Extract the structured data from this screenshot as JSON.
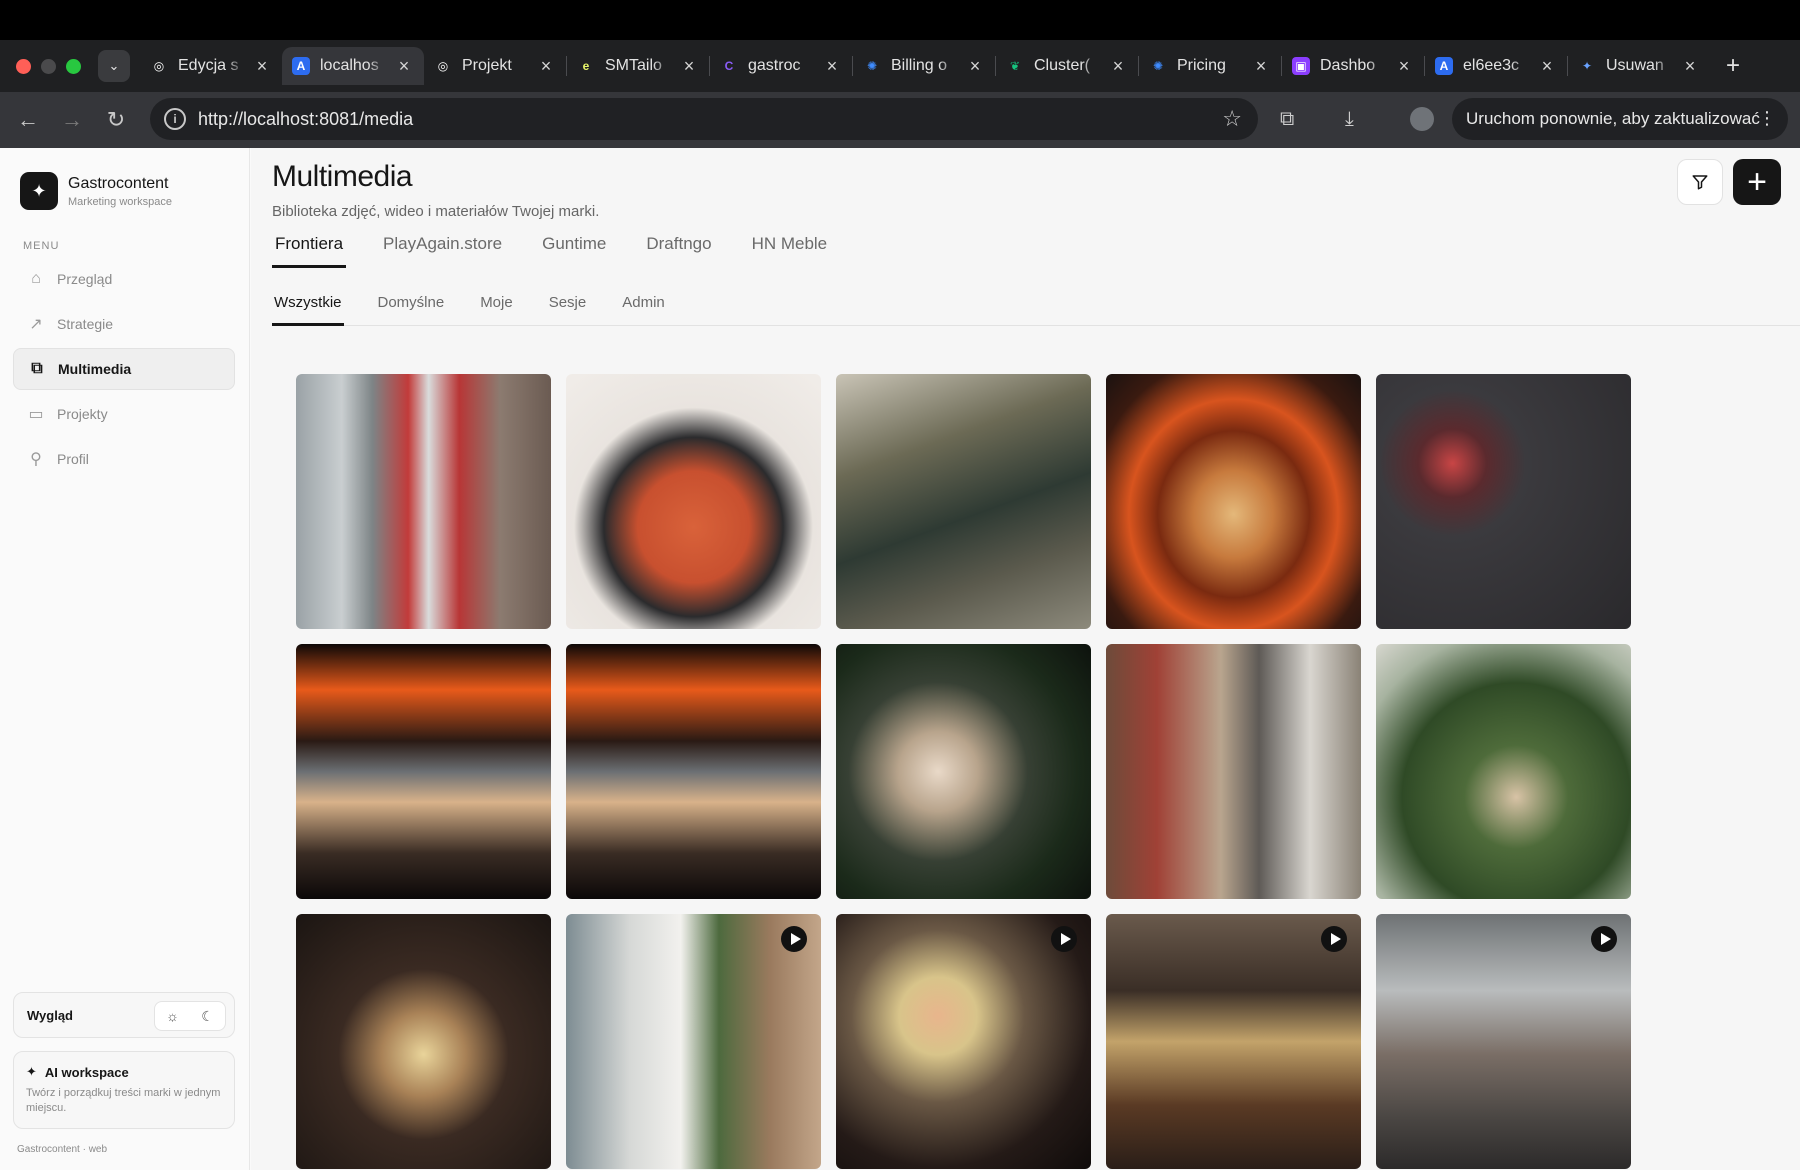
{
  "browser": {
    "tabs": [
      {
        "title": "Edycja s",
        "icon": "openai-icon",
        "color": "#ffffff"
      },
      {
        "title": "localhos",
        "icon": "a-logo-icon",
        "color": "#4d8bf5",
        "active": true
      },
      {
        "title": "Projekt",
        "icon": "openai-icon",
        "color": "#ffffff"
      },
      {
        "title": "SMTailo",
        "icon": "e-logo-icon",
        "color": "#e6f46a"
      },
      {
        "title": "gastroc",
        "icon": "c-logo-icon",
        "color": "#8a5cf6"
      },
      {
        "title": "Billing o",
        "icon": "gear-logo-icon",
        "color": "#3f8cff"
      },
      {
        "title": "Cluster(",
        "icon": "leaf-icon",
        "color": "#16c47f"
      },
      {
        "title": "Pricing",
        "icon": "gear-logo-icon",
        "color": "#3f8cff"
      },
      {
        "title": "Dashbo",
        "icon": "chat-logo-icon",
        "color": "#8b3dff"
      },
      {
        "title": "el6ee3c",
        "icon": "a-logo-icon",
        "color": "#4d8bf5"
      },
      {
        "title": "Usuwan",
        "icon": "gemini-icon",
        "color": "#6aa3ff"
      }
    ],
    "url": "http://localhost:8081/media",
    "update_label": "Uruchom ponownie, aby zaktualizować"
  },
  "sidebar": {
    "brand_name": "Gastrocontent",
    "brand_sub": "Marketing workspace",
    "menu_label": "MENU",
    "items": [
      {
        "label": "Przegląd",
        "icon": "home-icon"
      },
      {
        "label": "Strategie",
        "icon": "trend-icon"
      },
      {
        "label": "Multimedia",
        "icon": "media-icon",
        "active": true
      },
      {
        "label": "Projekty",
        "icon": "folder-icon"
      },
      {
        "label": "Profil",
        "icon": "user-icon"
      }
    ],
    "appearance_label": "Wygląd",
    "ai_title": "AI workspace",
    "ai_desc": "Twórz i porządkuj treści marki w jednym miejscu.",
    "footer": "Gastrocontent · web"
  },
  "main": {
    "title": "Multimedia",
    "subtitle": "Biblioteka zdjęć, wideo i materiałów Twojej marki.",
    "brand_tabs": [
      "Frontiera",
      "PlayAgain.store",
      "Guntime",
      "Draftngo",
      "HN Meble"
    ],
    "filter_tabs": [
      "Wszystkie",
      "Domyślne",
      "Moje",
      "Sesje",
      "Admin"
    ]
  },
  "media": [
    {
      "type": "image",
      "bg": "linear-gradient(90deg,#9aa2a6 0%,#c9ced0 18%,#7d8486 30%,#c23b3a 44%,#d9dcdc 52%,#b83636 64%,#8c7b70 80%,#6b5b52 100%)"
    },
    {
      "type": "image",
      "bg": "radial-gradient(circle at 50% 60%,#d9623a 0%,#c8502f 28%,#2b2b2d 45%,#e9e4df 60%,#f1ede9 100%)"
    },
    {
      "type": "image",
      "bg": "linear-gradient(160deg,#c9c4b6 0%,#6c6a55 30%,#2e3a33 55%,#5b5a4d 75%,#8d8a7c 100%)"
    },
    {
      "type": "image",
      "bg": "radial-gradient(ellipse at 50% 55%,#e4b87a 0%,#c77a3d 22%,#7a2a10 42%,#d8541e 58%,#3a1a10 80%,#1b1210 100%)"
    },
    {
      "type": "image",
      "bg": "radial-gradient(circle at 30% 35%,#c84545 0%,#5b2a2e 14%,#3b3a3e 30%,#2a292c 100%)"
    },
    {
      "type": "image",
      "bg": "linear-gradient(180deg,#0d0807 0%,#e85a1a 18%,#2a1a14 38%,#6b6f73 50%,#d8b28a 62%,#3a2c24 82%,#0b0808 100%)"
    },
    {
      "type": "image",
      "bg": "linear-gradient(180deg,#0d0807 0%,#e85a1a 18%,#2a1a14 38%,#6b6f73 50%,#d8b28a 62%,#3a2c24 82%,#0b0808 100%)"
    },
    {
      "type": "image",
      "bg": "radial-gradient(circle at 40% 50%,#e9d9c8 0%,#b8a48c 20%,#374034 45%,#1b2a1a 70%,#0d120d 100%)"
    },
    {
      "type": "image",
      "bg": "linear-gradient(90deg,#6d4b3a 0%,#a04136 20%,#b9a58e 45%,#5e5a56 60%,#d9d6d0 80%,#8a8276 100%)"
    },
    {
      "type": "image",
      "bg": "radial-gradient(circle at 55% 60%,#d8c3a6 0%,#4e6b3a 25%,#2f4a26 55%,#a7b3a0 80%,#d7d7cf 100%)"
    },
    {
      "type": "image",
      "bg": "radial-gradient(circle at 50% 55%,#e9d49a 0%,#a98257 22%,#3a2a22 45%,#1b1512 100%)"
    },
    {
      "type": "video",
      "bg": "linear-gradient(90deg,#7d8c92 0%,#d6d8d6 25%,#f2f1ee 45%,#4d6a3e 60%,#9a7a5e 80%,#c3a68a 100%)"
    },
    {
      "type": "video",
      "bg": "radial-gradient(circle at 40% 40%,#e8b58c 0%,#d8c48a 18%,#6a5845 40%,#241a17 70%,#0f0b0a 100%)"
    },
    {
      "type": "video",
      "bg": "linear-gradient(180deg,#6a5a4c 0%,#3a2e26 30%,#c3a36a 50%,#5a3a24 75%,#2a1e18 100%)"
    },
    {
      "type": "video",
      "bg": "linear-gradient(180deg,#6e7274 0%,#b9bcbd 30%,#7a6e66 55%,#4a4643 80%,#2c2a2a 100%)"
    }
  ]
}
